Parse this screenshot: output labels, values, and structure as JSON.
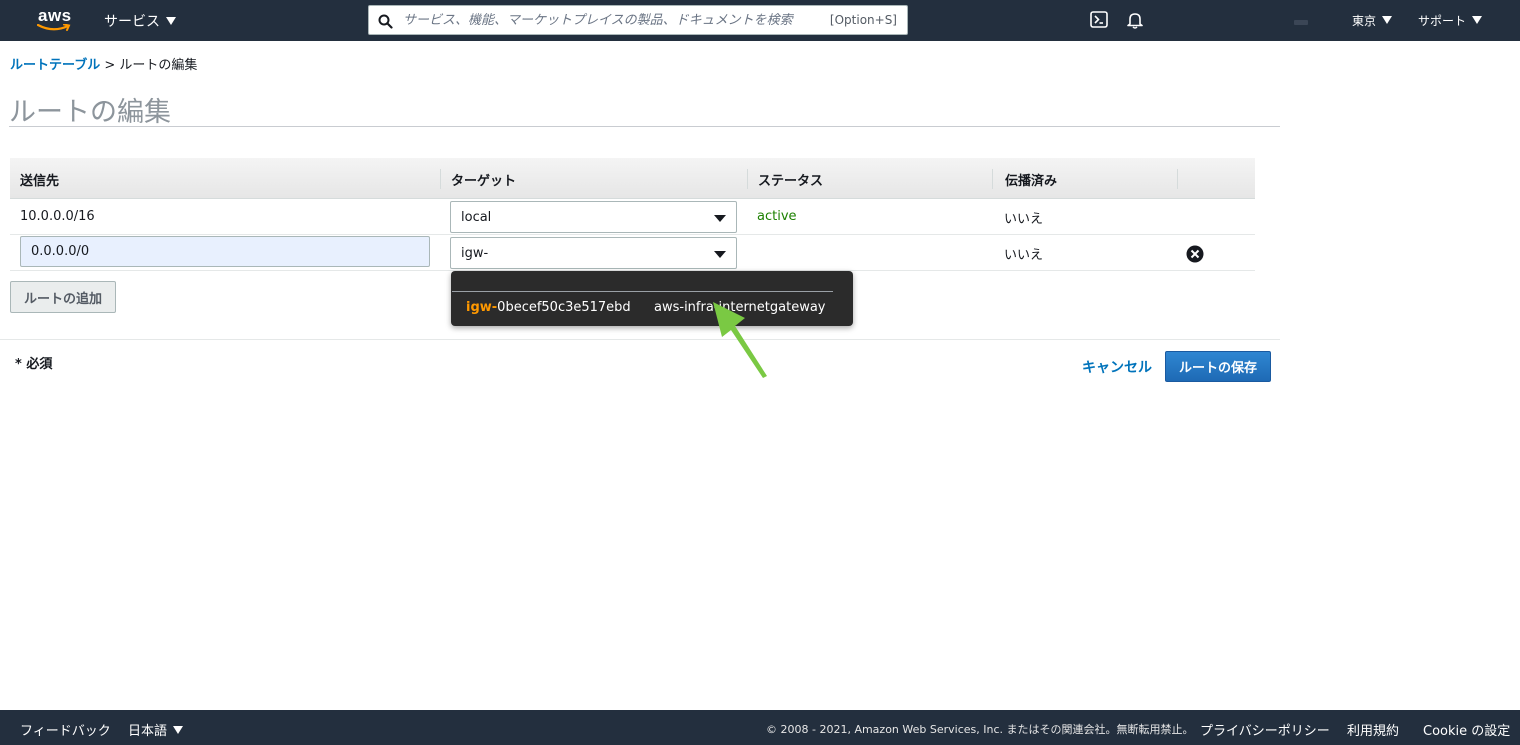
{
  "topnav": {
    "logo_text": "aws",
    "services_label": "サービス",
    "search_placeholder": "サービス、機能、マーケットプレイスの製品、ドキュメントを検索",
    "search_shortcut": "[Option+S]",
    "region_label": "東京",
    "support_label": "サポート"
  },
  "breadcrumb": {
    "parent": "ルートテーブル",
    "separator": ">",
    "current": "ルートの編集"
  },
  "page_title": "ルートの編集",
  "table": {
    "headers": [
      "送信先",
      "ターゲット",
      "ステータス",
      "伝播済み"
    ],
    "rows": [
      {
        "destination": "10.0.0.0/16",
        "target": "local",
        "status": "active",
        "propagated": "いいえ"
      },
      {
        "destination": "0.0.0.0/0",
        "target": "igw-",
        "status": "",
        "propagated": "いいえ"
      }
    ]
  },
  "dropdown": {
    "option_id_match": "igw-",
    "option_id_rest": "0becef50c3e517ebd",
    "option_name": "aws-infra-internetgateway"
  },
  "actions": {
    "add_route": "ルートの追加",
    "required_note": "* 必須",
    "cancel": "キャンセル",
    "save": "ルートの保存"
  },
  "footer": {
    "feedback": "フィードバック",
    "language": "日本語",
    "copyright": "© 2008 - 2021, Amazon Web Services, Inc. またはその関連会社。無断転用禁止。",
    "privacy": "プライバシーポリシー",
    "terms": "利用規約",
    "cookie": "Cookie の設定"
  },
  "colors": {
    "nav_bg": "#232f3e",
    "link": "#0073bb",
    "status_active": "#1d8102",
    "highlight": "#ff9900",
    "primary_button": "#1e6ab5",
    "annotation_arrow": "#7ac943"
  }
}
